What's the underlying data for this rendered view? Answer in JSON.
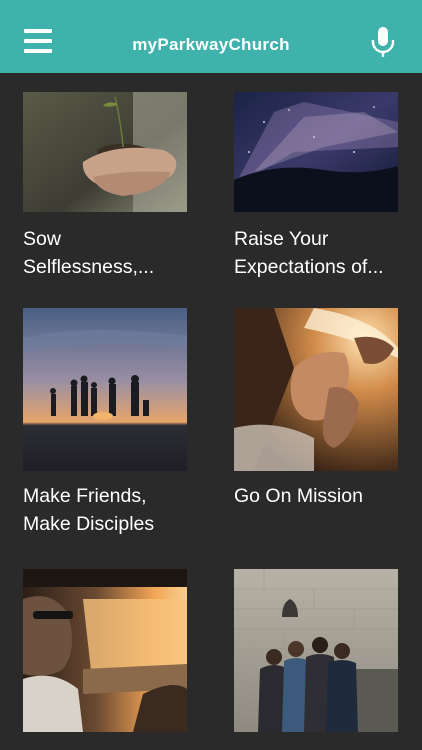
{
  "header": {
    "title": "myParkwayChurch",
    "menu_icon": "hamburger-menu-icon",
    "mic_icon": "microphone-icon",
    "background": "#3fb3ab"
  },
  "feed": {
    "items": [
      {
        "label_line1": "Sow",
        "label_line2": "Selflessness,..."
      },
      {
        "label_line1": "Raise Your",
        "label_line2": "Expectations of..."
      },
      {
        "label_line1": "Make Friends,",
        "label_line2": "Make Disciples"
      },
      {
        "label_line1": "Go On Mission",
        "label_line2": ""
      },
      {
        "label_line1": "",
        "label_line2": ""
      },
      {
        "label_line1": "",
        "label_line2": ""
      }
    ]
  }
}
